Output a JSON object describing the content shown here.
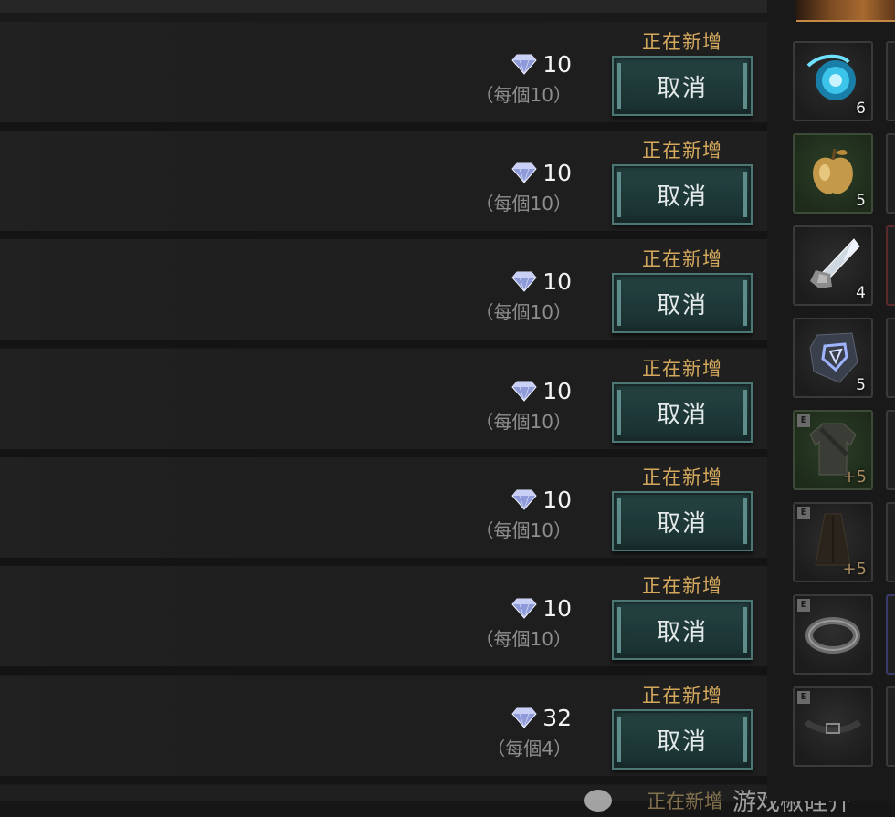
{
  "listings": [
    {
      "price": "10",
      "unit": "（每個10）",
      "status": "正在新增",
      "cancel_label": "取消"
    },
    {
      "price": "10",
      "unit": "（每個10）",
      "status": "正在新增",
      "cancel_label": "取消"
    },
    {
      "price": "10",
      "unit": "（每個10）",
      "status": "正在新增",
      "cancel_label": "取消"
    },
    {
      "price": "10",
      "unit": "（每個10）",
      "status": "正在新增",
      "cancel_label": "取消"
    },
    {
      "price": "10",
      "unit": "（每個10）",
      "status": "正在新增",
      "cancel_label": "取消"
    },
    {
      "price": "10",
      "unit": "（每個10）",
      "status": "正在新增",
      "cancel_label": "取消"
    },
    {
      "price": "32",
      "unit": "（每個4）",
      "status": "正在新增",
      "cancel_label": "取消"
    }
  ],
  "footer": {
    "status_partial": "正在新增",
    "watermark": "游戏椒硅齐"
  },
  "inventory": [
    {
      "icon": "blue-orb-icon",
      "count": "6"
    },
    {
      "icon": "golden-apple-icon",
      "count": "5"
    },
    {
      "icon": "crystal-shard-icon",
      "count": "4"
    },
    {
      "icon": "rune-stone-icon",
      "count": "5"
    },
    {
      "icon": "armor-tunic-icon",
      "grade": "E",
      "enhance": "+5"
    },
    {
      "icon": "cloak-icon",
      "grade": "E",
      "enhance": "+5"
    },
    {
      "icon": "bracelet-icon",
      "grade": "E"
    },
    {
      "icon": "belt-icon",
      "grade": "E"
    }
  ],
  "colors": {
    "status_gold": "#d4a95d",
    "button_teal": "#1e3838",
    "gem_blue": "#8f9ad8"
  }
}
